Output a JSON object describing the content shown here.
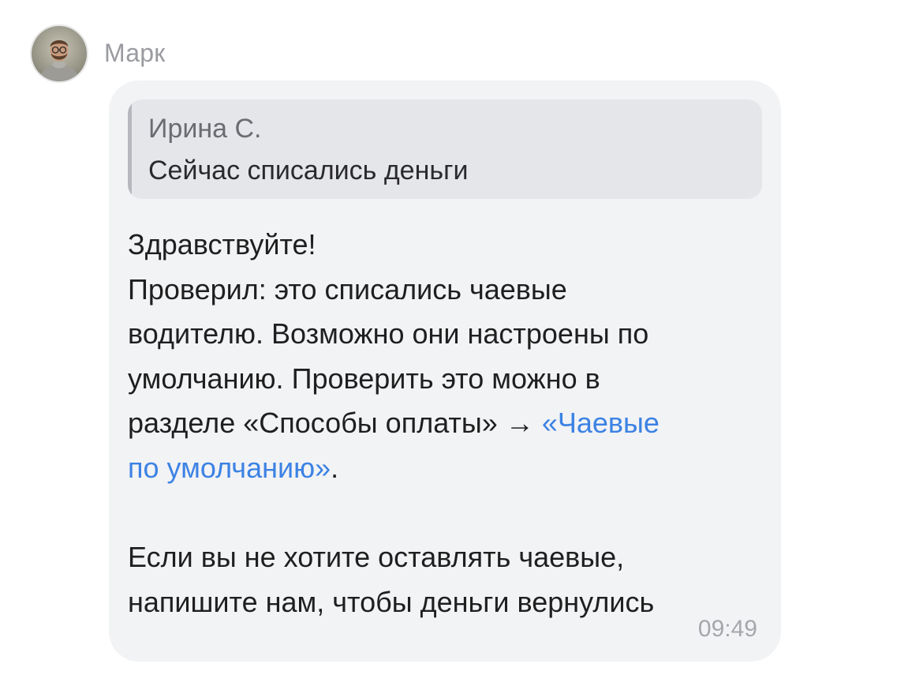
{
  "sender": {
    "name": "Марк"
  },
  "message": {
    "quote": {
      "author": "Ирина С.",
      "text": "Сейчас списались деньги"
    },
    "greeting": "Здравствуйте!",
    "para1_line1": "Проверил: это списались чаевые",
    "para1_line2": "водителю. Возможно они настроены по",
    "para1_line3": "умолчанию. Проверить это можно в",
    "para1_line4_text": "разделе «Способы оплаты» → ",
    "link_part1": "«Чаевые",
    "link_part2": "по умолчанию»",
    "para1_end": ".",
    "para2_line1": "Если вы не хотите оставлять чаевые,",
    "para2_line2": "напишите нам, чтобы деньги вернулись",
    "time": "09:49"
  },
  "colors": {
    "bubble_bg": "#f2f3f5",
    "quote_bg": "#e5e6ea",
    "link": "#3c82e4",
    "muted_text": "#9a9ba0"
  },
  "icons": {
    "avatar": "user-photo-avatar"
  }
}
